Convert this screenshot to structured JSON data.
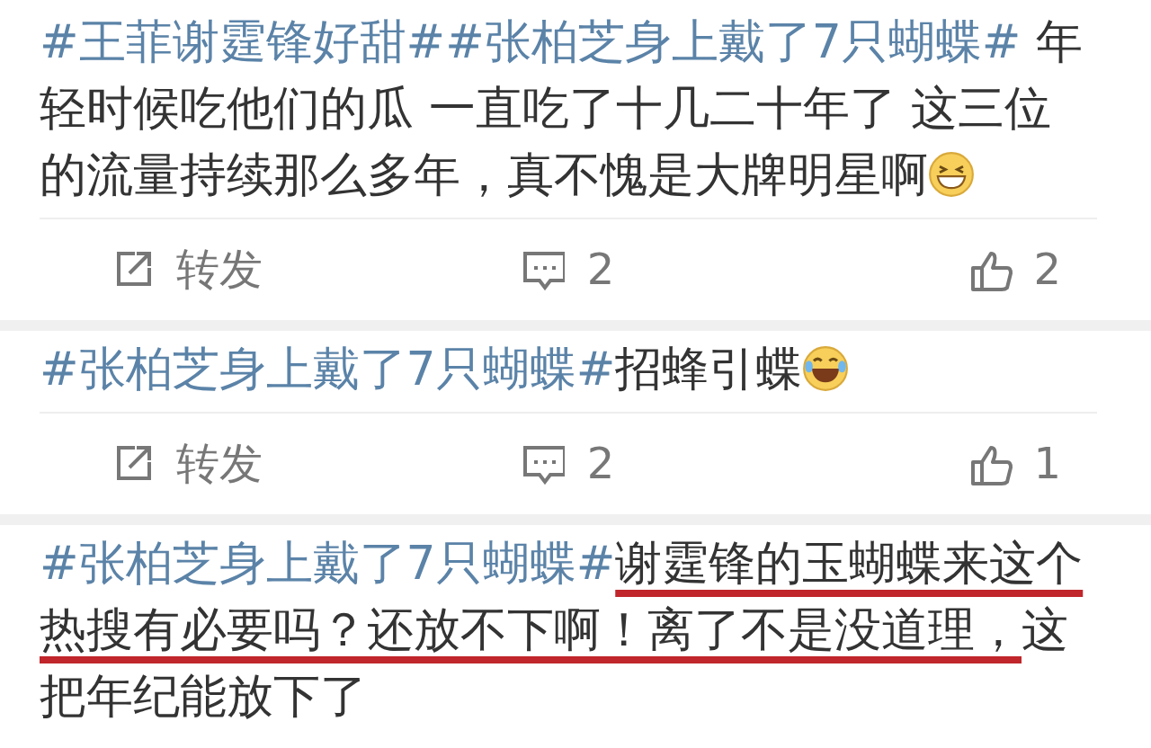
{
  "posts": [
    {
      "segments": [
        {
          "kind": "hashtag",
          "text": "#王菲谢霆锋好甜#"
        },
        {
          "kind": "hashtag",
          "text": "#张柏芝身上戴了7只蝴蝶#"
        },
        {
          "kind": "text",
          "text": " 年轻时候吃他们的瓜 一直吃了十几二十年了 这三位的流量持续那么多年，真不愧是大牌明星啊"
        },
        {
          "kind": "grin-emoji"
        }
      ],
      "actions": {
        "repost": "转发",
        "comments": "2",
        "likes": "2"
      }
    },
    {
      "segments": [
        {
          "kind": "hashtag",
          "text": "#张柏芝身上戴了7只蝴蝶#"
        },
        {
          "kind": "text",
          "text": "招蜂引蝶"
        },
        {
          "kind": "laugh-emoji"
        }
      ],
      "actions": {
        "repost": "转发",
        "comments": "2",
        "likes": "1"
      }
    },
    {
      "segments": [
        {
          "kind": "hashtag",
          "text": "#张柏芝身上戴了7只蝴蝶#"
        },
        {
          "kind": "text",
          "text": "谢霆锋的玉蝴蝶来这个热搜有必要吗？还放不下啊！离了不是没道理，",
          "underlined": true
        },
        {
          "kind": "text",
          "text": "这把年纪能放下了"
        }
      ]
    }
  ]
}
